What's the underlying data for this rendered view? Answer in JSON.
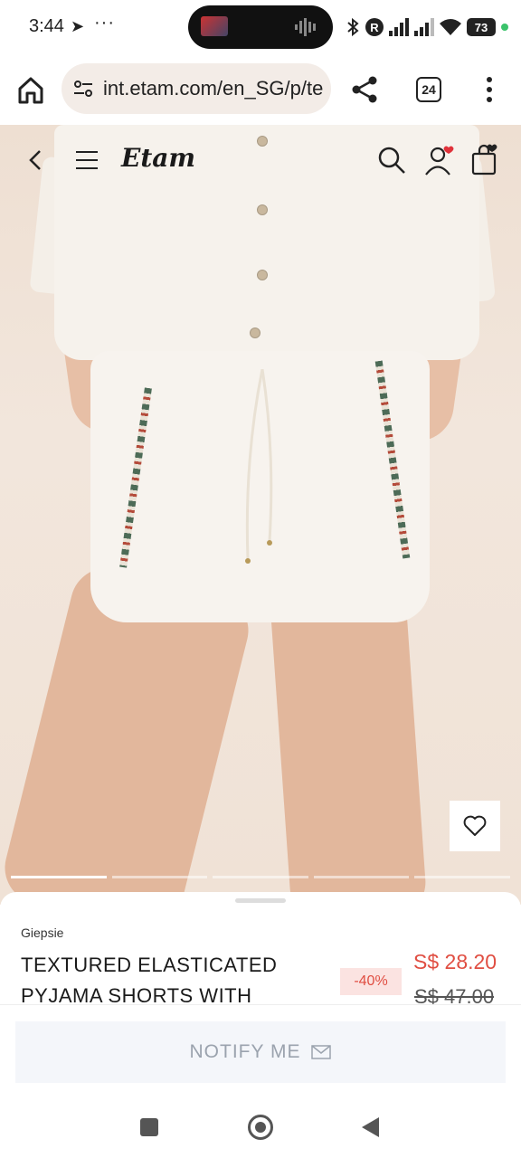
{
  "status_bar": {
    "time": "3:44",
    "extra": "···",
    "battery": "73",
    "colors": {
      "dot": "#3bc36b"
    }
  },
  "browser": {
    "url": "int.etam.com/en_SG/p/te",
    "tab_count": "24"
  },
  "site_nav": {
    "logo": "Etam"
  },
  "carousel": {
    "slides": 5,
    "active_index": 0
  },
  "product": {
    "brand": "Giepsie",
    "title": "TEXTURED ELASTICATED PYJAMA SHORTS WITH",
    "discount": "-40%",
    "price": "S$ 28.20",
    "old_price": "S$ 47.00"
  },
  "footer": {
    "notify_label": "NOTIFY ME"
  },
  "colors": {
    "accent": "#e04e42",
    "discount_bg": "#fbe3e1",
    "notify_bg": "#f4f6fa"
  }
}
